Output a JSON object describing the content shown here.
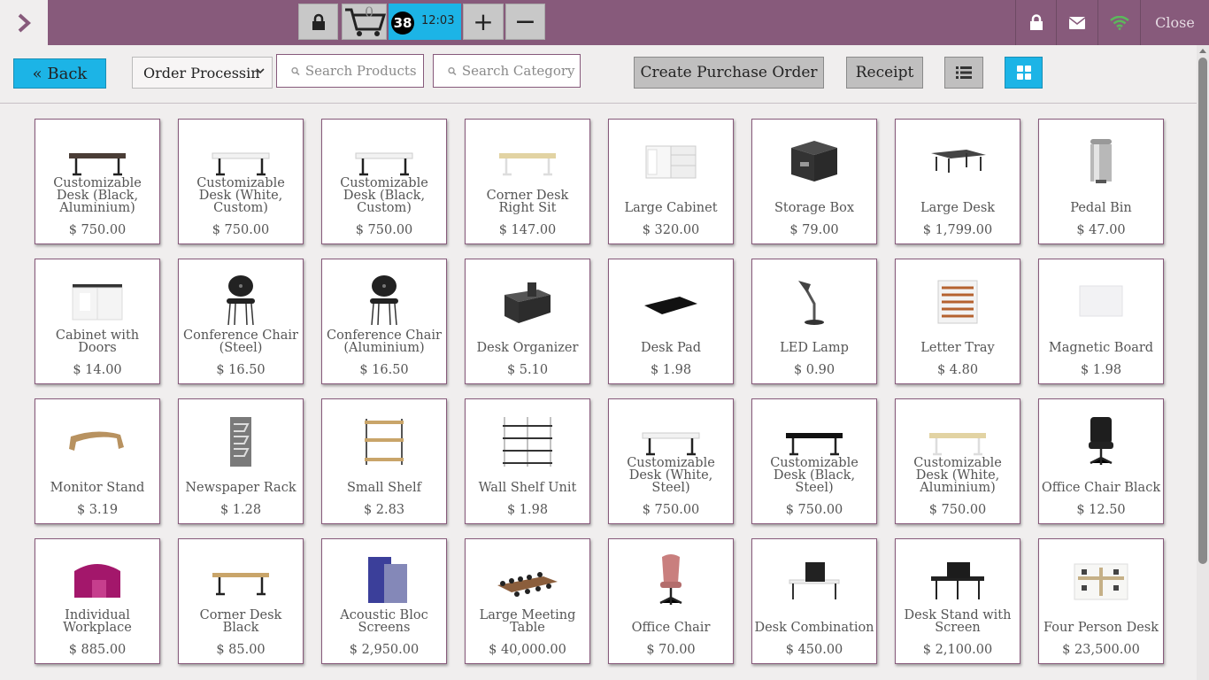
{
  "header": {
    "cart_count": "0",
    "order_number": "38",
    "order_time": "12:03",
    "plus_label": "+",
    "minus_label": "−",
    "close_label": "Close"
  },
  "controls": {
    "back_label": "« Back",
    "select_value": "Order Processin",
    "search_products_placeholder": "Search Products",
    "search_category_placeholder": "Search Category",
    "create_po_label": "Create Purchase Order",
    "receipt_label": "Receipt"
  },
  "colors": {
    "primary": "#875a7b",
    "accent": "#1cb4e6",
    "wifi": "#5cb85c"
  },
  "products": [
    {
      "name": "Customizable Desk (Black, Aluminium)",
      "price": "$ 750.00",
      "icon": "desk-dark"
    },
    {
      "name": "Customizable Desk (White, Custom)",
      "price": "$ 750.00",
      "icon": "desk-white"
    },
    {
      "name": "Customizable Desk (Black, Custom)",
      "price": "$ 750.00",
      "icon": "desk-white"
    },
    {
      "name": "Corner Desk Right Sit",
      "price": "$ 147.00",
      "icon": "desk-beige"
    },
    {
      "name": "Large Cabinet",
      "price": "$ 320.00",
      "icon": "cabinet-open"
    },
    {
      "name": "Storage Box",
      "price": "$ 79.00",
      "icon": "storage-box"
    },
    {
      "name": "Large Desk",
      "price": "$ 1,799.00",
      "icon": "large-desk"
    },
    {
      "name": "Pedal Bin",
      "price": "$ 47.00",
      "icon": "pedal-bin"
    },
    {
      "name": "Cabinet with Doors",
      "price": "$ 14.00",
      "icon": "cabinet-doors"
    },
    {
      "name": "Conference Chair (Steel)",
      "price": "$ 16.50",
      "icon": "conference-chair"
    },
    {
      "name": "Conference Chair (Aluminium)",
      "price": "$ 16.50",
      "icon": "conference-chair"
    },
    {
      "name": "Desk Organizer",
      "price": "$ 5.10",
      "icon": "desk-organizer"
    },
    {
      "name": "Desk Pad",
      "price": "$ 1.98",
      "icon": "desk-pad"
    },
    {
      "name": "LED Lamp",
      "price": "$ 0.90",
      "icon": "led-lamp"
    },
    {
      "name": "Letter Tray",
      "price": "$ 4.80",
      "icon": "letter-tray"
    },
    {
      "name": "Magnetic Board",
      "price": "$ 1.98",
      "icon": "magnetic-board"
    },
    {
      "name": "Monitor Stand",
      "price": "$ 3.19",
      "icon": "monitor-stand"
    },
    {
      "name": "Newspaper Rack",
      "price": "$ 1.28",
      "icon": "newspaper-rack"
    },
    {
      "name": "Small Shelf",
      "price": "$ 2.83",
      "icon": "small-shelf"
    },
    {
      "name": "Wall Shelf Unit",
      "price": "$ 1.98",
      "icon": "wall-shelf"
    },
    {
      "name": "Customizable Desk (White, Steel)",
      "price": "$ 750.00",
      "icon": "desk-white"
    },
    {
      "name": "Customizable Desk (Black, Steel)",
      "price": "$ 750.00",
      "icon": "desk-black"
    },
    {
      "name": "Customizable Desk (White, Aluminium)",
      "price": "$ 750.00",
      "icon": "desk-beige"
    },
    {
      "name": "Office Chair Black",
      "price": "$ 12.50",
      "icon": "office-chair-black"
    },
    {
      "name": "Individual Workplace",
      "price": "$ 885.00",
      "icon": "individual-workplace"
    },
    {
      "name": "Corner Desk Black",
      "price": "$ 85.00",
      "icon": "desk-wood"
    },
    {
      "name": "Acoustic Bloc Screens",
      "price": "$ 2,950.00",
      "icon": "acoustic-screens"
    },
    {
      "name": "Large Meeting Table",
      "price": "$ 40,000.00",
      "icon": "meeting-table"
    },
    {
      "name": "Office Chair",
      "price": "$ 70.00",
      "icon": "office-chair-pink"
    },
    {
      "name": "Desk Combination",
      "price": "$ 450.00",
      "icon": "desk-combination"
    },
    {
      "name": "Desk Stand with Screen",
      "price": "$ 2,100.00",
      "icon": "desk-screen"
    },
    {
      "name": "Four Person Desk",
      "price": "$ 23,500.00",
      "icon": "four-person-desk"
    }
  ]
}
